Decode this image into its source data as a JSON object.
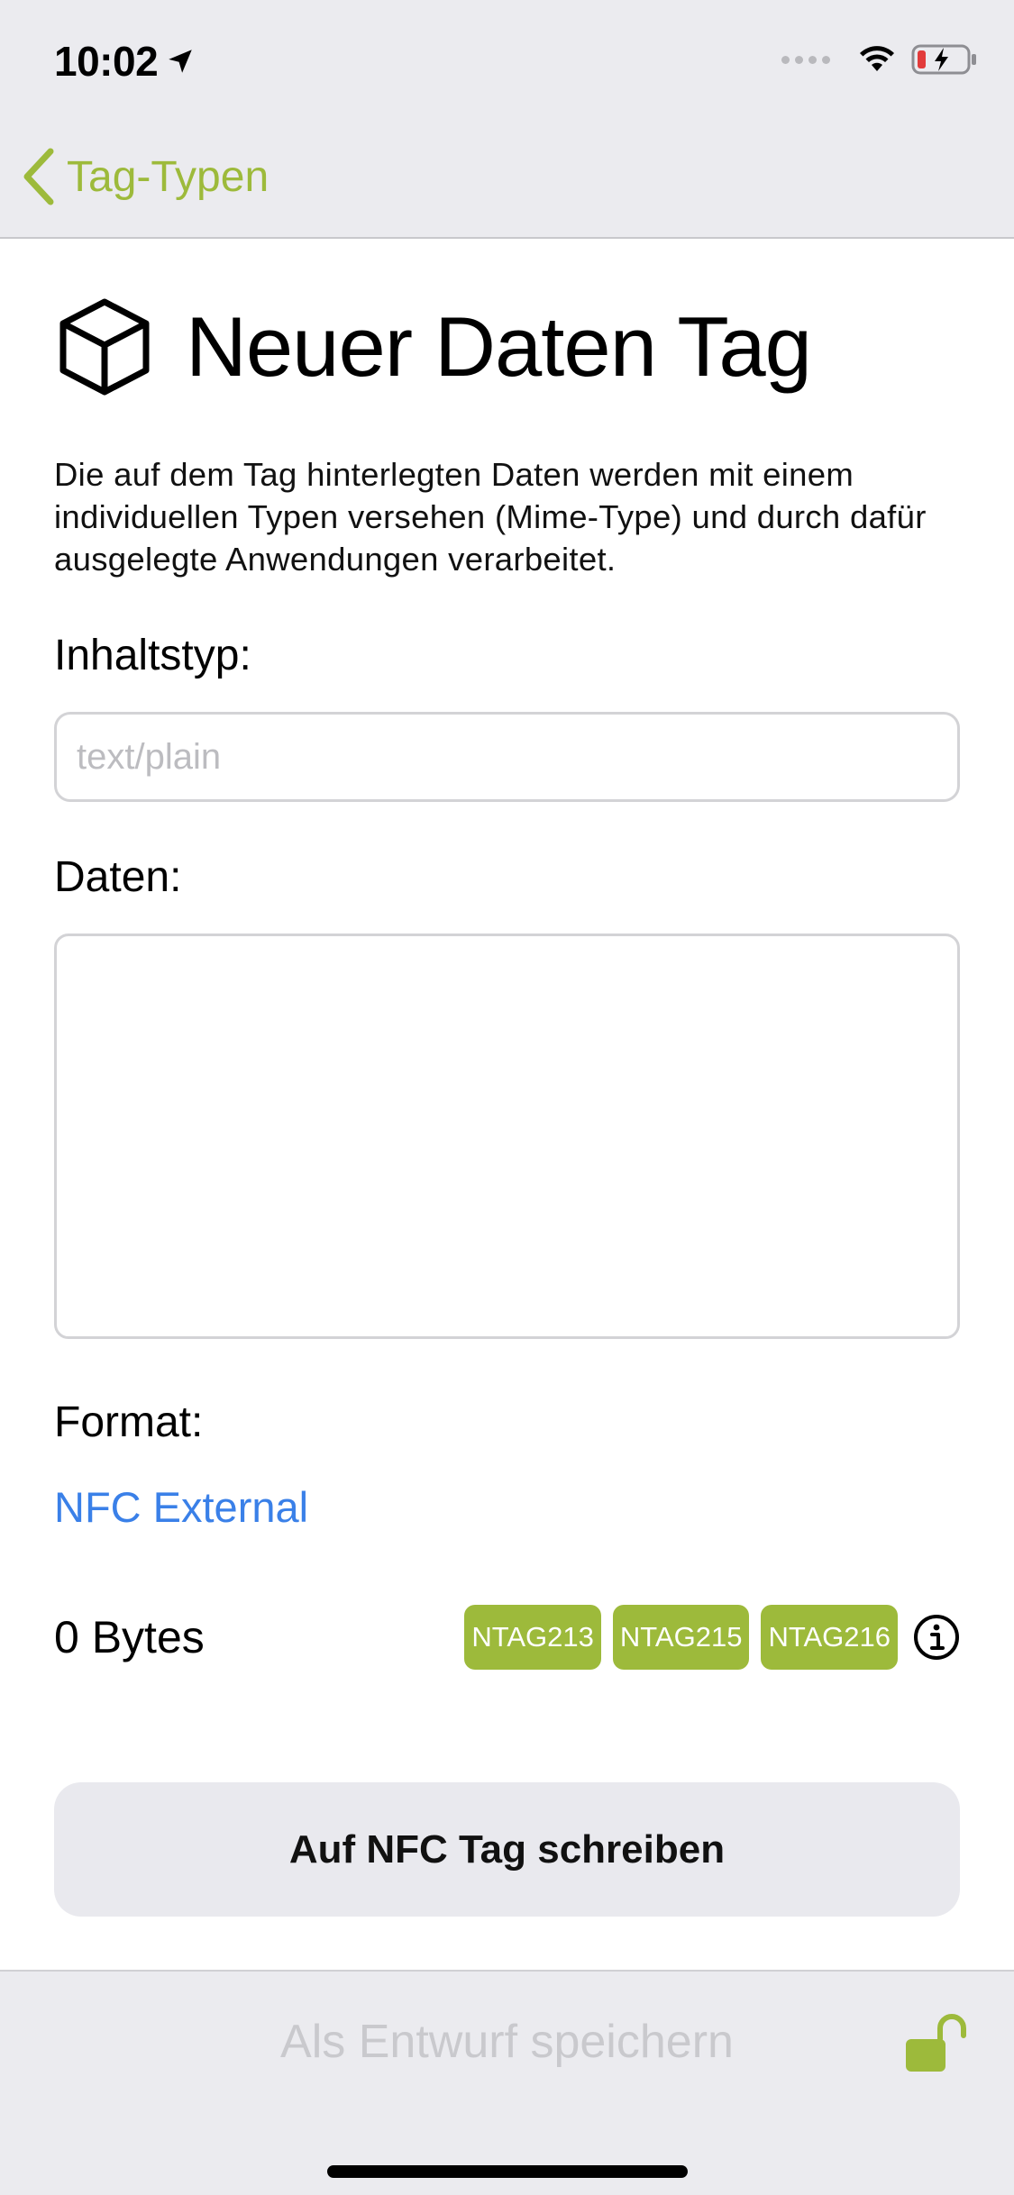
{
  "status_bar": {
    "time": "10:02"
  },
  "nav": {
    "back_label": "Tag-Typen"
  },
  "page": {
    "title": "Neuer Daten Tag",
    "description": "Die auf dem Tag hinterlegten Daten werden mit einem individuellen Typen versehen (Mime-Type) und durch dafür ausgelegte Anwendungen verarbeitet."
  },
  "form": {
    "content_type_label": "Inhaltstyp:",
    "content_type_value": "",
    "content_type_placeholder": "text/plain",
    "data_label": "Daten:",
    "data_value": "",
    "format_label": "Format:",
    "format_value": "NFC External"
  },
  "capacity": {
    "bytes_text": "0 Bytes",
    "chips": [
      "NTAG213",
      "NTAG215",
      "NTAG216"
    ]
  },
  "actions": {
    "write_label": "Auf NFC Tag schreiben",
    "draft_label": "Als Entwurf speichern"
  },
  "colors": {
    "accent_green": "#9dba3b",
    "link_blue": "#3a80e8",
    "bar_grey": "#ebebef"
  },
  "icons": {
    "location": "location-arrow-icon",
    "wifi": "wifi-icon",
    "battery": "battery-charging-icon",
    "back": "chevron-left-icon",
    "title": "cube-icon",
    "info": "info-icon",
    "lock": "unlock-icon"
  }
}
